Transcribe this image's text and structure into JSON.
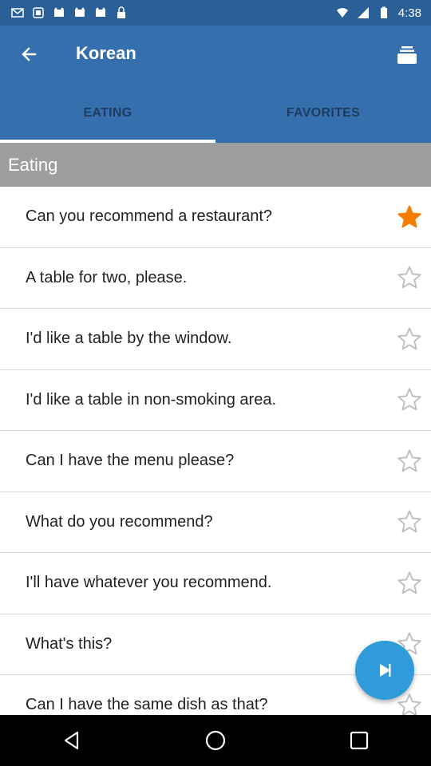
{
  "status_bar": {
    "time": "4:38",
    "left_icons": [
      "mail-icon",
      "notification-icon",
      "cat-icon",
      "cat-icon",
      "cat-icon",
      "lock-icon"
    ],
    "right_icons": [
      "wifi-icon",
      "signal-icon",
      "battery-icon"
    ]
  },
  "appbar": {
    "title": "Korean"
  },
  "tabs": [
    {
      "label": "EATING",
      "active": true
    },
    {
      "label": "FAVORITES",
      "active": false
    }
  ],
  "section": {
    "title": "Eating"
  },
  "phrases": [
    {
      "text": "Can you recommend a restaurant?",
      "favorite": true
    },
    {
      "text": "A table for two, please.",
      "favorite": false
    },
    {
      "text": "I'd like a table by the window.",
      "favorite": false
    },
    {
      "text": "I'd like a table in non-smoking area.",
      "favorite": false
    },
    {
      "text": "Can I have the menu please?",
      "favorite": false
    },
    {
      "text": "What do you recommend?",
      "favorite": false
    },
    {
      "text": "I'll have whatever you recommend.",
      "favorite": false
    },
    {
      "text": "What's this?",
      "favorite": false
    },
    {
      "text": "Can I have the same dish as that?",
      "favorite": false
    }
  ],
  "colors": {
    "status_bar": "#2A5F97",
    "app_bar": "#356FAE",
    "section_header": "#9E9E9E",
    "star_active": "#F57C00",
    "star_inactive": "#BDBDBD",
    "fab": "#2F9BDA"
  },
  "fab": {
    "icon": "play-icon"
  },
  "nav_bar": {
    "buttons": [
      "back-nav-icon",
      "home-nav-icon",
      "recents-nav-icon"
    ]
  }
}
